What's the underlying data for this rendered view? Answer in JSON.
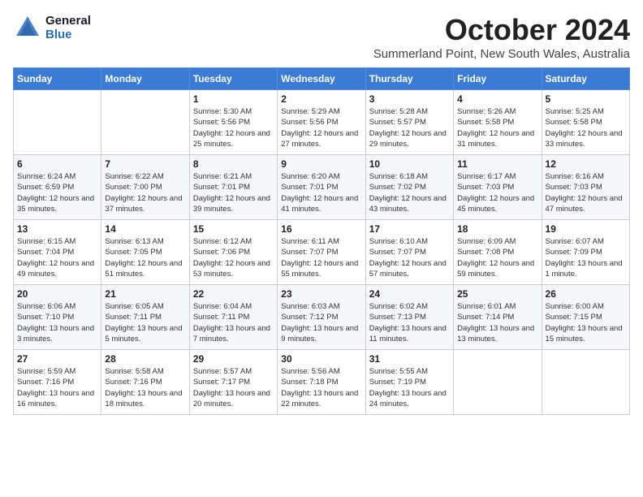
{
  "header": {
    "logo_general": "General",
    "logo_blue": "Blue",
    "month_title": "October 2024",
    "subtitle": "Summerland Point, New South Wales, Australia"
  },
  "days_of_week": [
    "Sunday",
    "Monday",
    "Tuesday",
    "Wednesday",
    "Thursday",
    "Friday",
    "Saturday"
  ],
  "weeks": [
    [
      {
        "day": "",
        "info": ""
      },
      {
        "day": "",
        "info": ""
      },
      {
        "day": "1",
        "info": "Sunrise: 5:30 AM\nSunset: 5:56 PM\nDaylight: 12 hours and 25 minutes."
      },
      {
        "day": "2",
        "info": "Sunrise: 5:29 AM\nSunset: 5:56 PM\nDaylight: 12 hours and 27 minutes."
      },
      {
        "day": "3",
        "info": "Sunrise: 5:28 AM\nSunset: 5:57 PM\nDaylight: 12 hours and 29 minutes."
      },
      {
        "day": "4",
        "info": "Sunrise: 5:26 AM\nSunset: 5:58 PM\nDaylight: 12 hours and 31 minutes."
      },
      {
        "day": "5",
        "info": "Sunrise: 5:25 AM\nSunset: 5:58 PM\nDaylight: 12 hours and 33 minutes."
      }
    ],
    [
      {
        "day": "6",
        "info": "Sunrise: 6:24 AM\nSunset: 6:59 PM\nDaylight: 12 hours and 35 minutes."
      },
      {
        "day": "7",
        "info": "Sunrise: 6:22 AM\nSunset: 7:00 PM\nDaylight: 12 hours and 37 minutes."
      },
      {
        "day": "8",
        "info": "Sunrise: 6:21 AM\nSunset: 7:01 PM\nDaylight: 12 hours and 39 minutes."
      },
      {
        "day": "9",
        "info": "Sunrise: 6:20 AM\nSunset: 7:01 PM\nDaylight: 12 hours and 41 minutes."
      },
      {
        "day": "10",
        "info": "Sunrise: 6:18 AM\nSunset: 7:02 PM\nDaylight: 12 hours and 43 minutes."
      },
      {
        "day": "11",
        "info": "Sunrise: 6:17 AM\nSunset: 7:03 PM\nDaylight: 12 hours and 45 minutes."
      },
      {
        "day": "12",
        "info": "Sunrise: 6:16 AM\nSunset: 7:03 PM\nDaylight: 12 hours and 47 minutes."
      }
    ],
    [
      {
        "day": "13",
        "info": "Sunrise: 6:15 AM\nSunset: 7:04 PM\nDaylight: 12 hours and 49 minutes."
      },
      {
        "day": "14",
        "info": "Sunrise: 6:13 AM\nSunset: 7:05 PM\nDaylight: 12 hours and 51 minutes."
      },
      {
        "day": "15",
        "info": "Sunrise: 6:12 AM\nSunset: 7:06 PM\nDaylight: 12 hours and 53 minutes."
      },
      {
        "day": "16",
        "info": "Sunrise: 6:11 AM\nSunset: 7:07 PM\nDaylight: 12 hours and 55 minutes."
      },
      {
        "day": "17",
        "info": "Sunrise: 6:10 AM\nSunset: 7:07 PM\nDaylight: 12 hours and 57 minutes."
      },
      {
        "day": "18",
        "info": "Sunrise: 6:09 AM\nSunset: 7:08 PM\nDaylight: 12 hours and 59 minutes."
      },
      {
        "day": "19",
        "info": "Sunrise: 6:07 AM\nSunset: 7:09 PM\nDaylight: 13 hours and 1 minute."
      }
    ],
    [
      {
        "day": "20",
        "info": "Sunrise: 6:06 AM\nSunset: 7:10 PM\nDaylight: 13 hours and 3 minutes."
      },
      {
        "day": "21",
        "info": "Sunrise: 6:05 AM\nSunset: 7:11 PM\nDaylight: 13 hours and 5 minutes."
      },
      {
        "day": "22",
        "info": "Sunrise: 6:04 AM\nSunset: 7:11 PM\nDaylight: 13 hours and 7 minutes."
      },
      {
        "day": "23",
        "info": "Sunrise: 6:03 AM\nSunset: 7:12 PM\nDaylight: 13 hours and 9 minutes."
      },
      {
        "day": "24",
        "info": "Sunrise: 6:02 AM\nSunset: 7:13 PM\nDaylight: 13 hours and 11 minutes."
      },
      {
        "day": "25",
        "info": "Sunrise: 6:01 AM\nSunset: 7:14 PM\nDaylight: 13 hours and 13 minutes."
      },
      {
        "day": "26",
        "info": "Sunrise: 6:00 AM\nSunset: 7:15 PM\nDaylight: 13 hours and 15 minutes."
      }
    ],
    [
      {
        "day": "27",
        "info": "Sunrise: 5:59 AM\nSunset: 7:16 PM\nDaylight: 13 hours and 16 minutes."
      },
      {
        "day": "28",
        "info": "Sunrise: 5:58 AM\nSunset: 7:16 PM\nDaylight: 13 hours and 18 minutes."
      },
      {
        "day": "29",
        "info": "Sunrise: 5:57 AM\nSunset: 7:17 PM\nDaylight: 13 hours and 20 minutes."
      },
      {
        "day": "30",
        "info": "Sunrise: 5:56 AM\nSunset: 7:18 PM\nDaylight: 13 hours and 22 minutes."
      },
      {
        "day": "31",
        "info": "Sunrise: 5:55 AM\nSunset: 7:19 PM\nDaylight: 13 hours and 24 minutes."
      },
      {
        "day": "",
        "info": ""
      },
      {
        "day": "",
        "info": ""
      }
    ]
  ]
}
